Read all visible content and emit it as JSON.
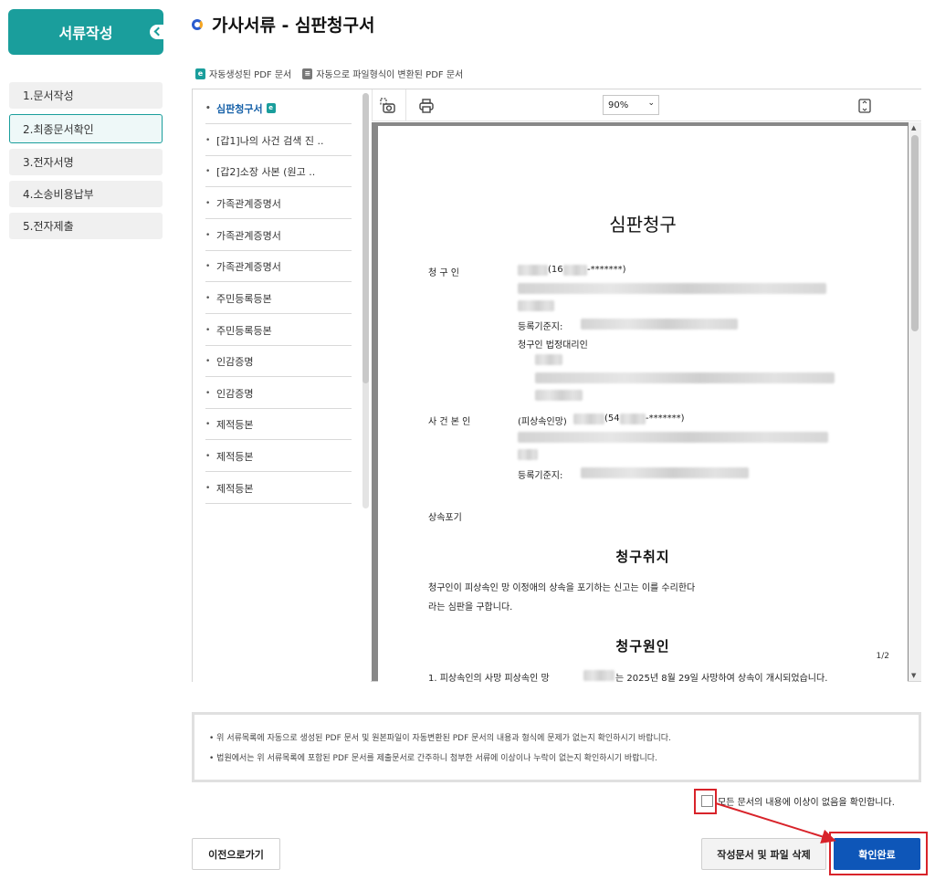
{
  "sidebar": {
    "header": "서류작성",
    "items": [
      {
        "label": "1.문서작성"
      },
      {
        "label": "2.최종문서확인"
      },
      {
        "label": "3.전자서명"
      },
      {
        "label": "4.소송비용납부"
      },
      {
        "label": "5.전자제출"
      }
    ]
  },
  "page": {
    "title": "가사서류 - 심판청구서",
    "legend": {
      "auto_pdf": "자동생성된 PDF 문서",
      "converted_pdf": "자동으로 파일형식이 변환된 PDF 문서"
    }
  },
  "doc_list": [
    {
      "label": "심판청구서"
    },
    {
      "label": "[갑1]나의 사건 검색 진 .."
    },
    {
      "label": "[갑2]소장 사본 (원고 .."
    },
    {
      "label": "가족관계증명서"
    },
    {
      "label": "가족관계증명서"
    },
    {
      "label": "가족관계증명서"
    },
    {
      "label": "주민등록등본"
    },
    {
      "label": "주민등록등본"
    },
    {
      "label": "인감증명"
    },
    {
      "label": "인감증명"
    },
    {
      "label": "제적등본"
    },
    {
      "label": "제적등본"
    },
    {
      "label": "제적등본"
    }
  ],
  "viewer": {
    "zoom": "90%",
    "icons": {
      "snapshot": "camera-snapshot-icon",
      "print": "printer-icon",
      "fit": "fit-page-icon"
    },
    "page_indicator": "1/2"
  },
  "document": {
    "title": "심판청구",
    "claimant_label": "청 구 인",
    "claimant_id": "(16",
    "claimant_id_mask": "-*******)",
    "claimant_base_addr": "등록기준지:",
    "claimant_rep": "청구인 법정대리인",
    "principal_label": "사 건 본 인",
    "principal_deceased": "(피상속인망)",
    "principal_id": "(54",
    "principal_id_mask": "-*******)",
    "principal_base_addr": "등록기준지:",
    "case_name": "상속포기",
    "purpose_heading": "청구취지",
    "purpose_line1": "청구인이 피상속인 망 이정애의 상속을 포기하는 신고는 이를 수리한다",
    "purpose_line2": "라는 심판을 구합니다.",
    "cause_heading": "청구원인",
    "cause_line1_a": "1. 피상속인의 사망 피상속인 망",
    "cause_line1_b": "는 2025년 8월 29일 사망하여 상속이 개시되었습니다."
  },
  "notice": {
    "line1": "위 서류목록에 자동으로 생성된 PDF 문서 및 원본파일이 자동변환된 PDF 문서의 내용과 형식에 문제가 없는지 확인하시기 바랍니다.",
    "line2": "법원에서는 위 서류목록에 포함된 PDF 문서를 제출문서로 간주하니 첨부한 서류에 이상이나 누락이 없는지 확인하시기 바랍니다."
  },
  "confirm": {
    "label": "모든 문서의 내용에 이상이 없음을 확인합니다.",
    "checked": false
  },
  "buttons": {
    "prev": "이전으로가기",
    "delete": "작성문서 및 파일 삭제",
    "confirm": "확인완료"
  },
  "colors": {
    "accent": "#1a9e9c",
    "primary_button": "#0e56b8",
    "highlight": "#d8232a"
  }
}
